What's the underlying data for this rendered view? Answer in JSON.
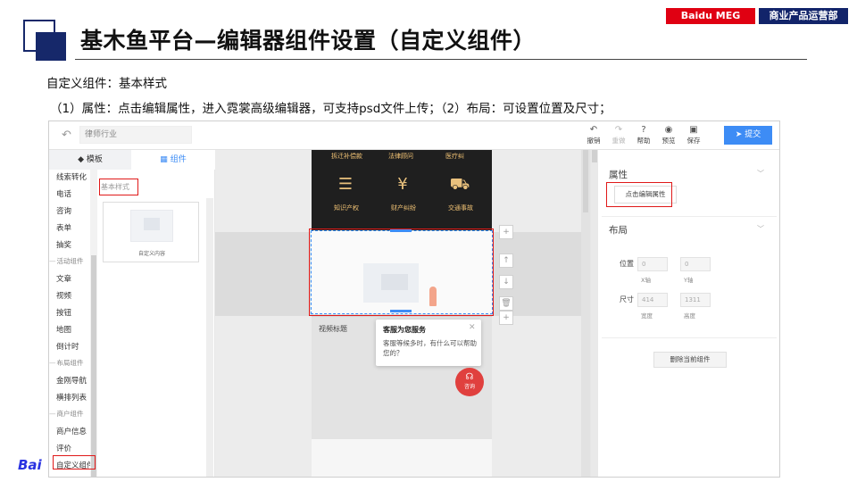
{
  "slide": {
    "title": "基木鱼平台—编辑器组件设置（自定义组件）",
    "badge_left": "Baidu MEG",
    "badge_right": "商业产品运营部",
    "desc_line1": "自定义组件：基本样式",
    "desc_line2": "（1）属性：点击编辑属性，进入霓裳高级编辑器，可支持psd文件上传；（2）布局：可设置位置及尺寸；",
    "logo_text": "Bai"
  },
  "toolbar": {
    "back_icon": "↶",
    "industry_value": "律师行业",
    "tools": [
      {
        "label": "撤销",
        "icon": "↶",
        "enabled": true
      },
      {
        "label": "重做",
        "icon": "↷",
        "enabled": false
      },
      {
        "label": "帮助",
        "icon": "?",
        "enabled": true
      },
      {
        "label": "预览",
        "icon": "◉",
        "enabled": true
      },
      {
        "label": "保存",
        "icon": "▣",
        "enabled": true
      }
    ],
    "submit_label": "提交",
    "submit_icon": "➤",
    "accent_color": "#3d8cf5"
  },
  "left_panel": {
    "tab_template": "模板",
    "tab_template_icon": "◆",
    "tab_component": "组件",
    "tab_component_icon": "▦",
    "categories": [
      {
        "kind": "item",
        "label": "线索转化"
      },
      {
        "kind": "item",
        "label": "电话"
      },
      {
        "kind": "item",
        "label": "咨询"
      },
      {
        "kind": "item",
        "label": "表单"
      },
      {
        "kind": "item",
        "label": "抽奖"
      },
      {
        "kind": "group",
        "label": "活动组件"
      },
      {
        "kind": "item",
        "label": "文章"
      },
      {
        "kind": "item",
        "label": "视频"
      },
      {
        "kind": "item",
        "label": "按钮"
      },
      {
        "kind": "item",
        "label": "地图"
      },
      {
        "kind": "item",
        "label": "倒计时"
      },
      {
        "kind": "group",
        "label": "布局组件"
      },
      {
        "kind": "item",
        "label": "金刚导航"
      },
      {
        "kind": "item",
        "label": "横排列表"
      },
      {
        "kind": "group",
        "label": "商户组件"
      },
      {
        "kind": "item",
        "label": "商户信息"
      },
      {
        "kind": "item",
        "label": "评价"
      },
      {
        "kind": "item",
        "label": "自定义组件"
      }
    ],
    "component_group_title": "基本样式",
    "component_card_label": "自定义内容"
  },
  "canvas": {
    "dark_grid": {
      "top_labels": [
        "拆迁补偿款",
        "法律顾问",
        "医疗纠"
      ],
      "items": [
        {
          "icon": "☰",
          "label": "知识产权"
        },
        {
          "icon": "¥",
          "label": "财产纠纷"
        },
        {
          "icon": "⛟",
          "label": "交通事故"
        }
      ]
    },
    "side_buttons": [
      "+",
      "↑",
      "↓",
      "🗑",
      "+"
    ],
    "video_title": "视频标题",
    "chat": {
      "title": "客服为您服务",
      "close_icon": "✕",
      "message": "客服等候多时，有什么可以帮助您的？",
      "fab_icon": "☊",
      "fab_label": "咨询"
    }
  },
  "right_panel": {
    "attr_section": "属性",
    "attr_button": "点击编辑属性",
    "layout_section": "布局",
    "position_label": "位置",
    "position_x": "0",
    "position_y": "0",
    "x_axis_label": "X轴",
    "y_axis_label": "Y轴",
    "size_label": "尺寸",
    "size_width": "414",
    "size_height": "1311",
    "width_label": "宽度",
    "height_label": "高度",
    "delete_button": "删除当前组件",
    "chevron_icon": "﹀"
  },
  "highlight_color": "#e01919"
}
